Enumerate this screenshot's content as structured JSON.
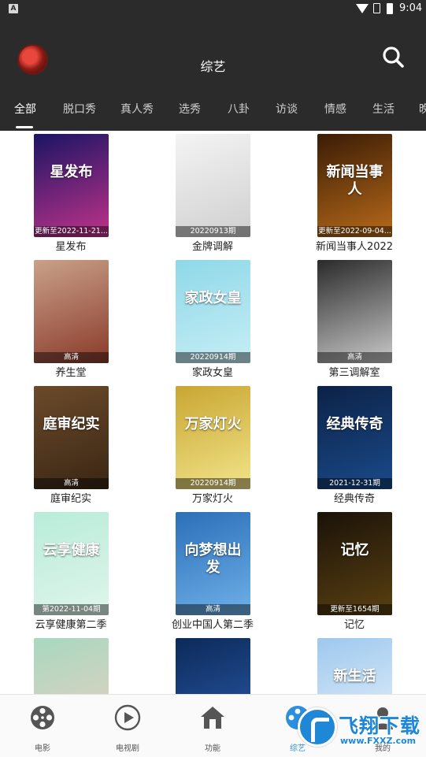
{
  "status_bar": {
    "notification_icon": "A",
    "time": "9:04"
  },
  "header": {
    "title": "综艺",
    "avatar": "avatar",
    "search_icon": "search-icon"
  },
  "tabs": [
    {
      "label": "全部",
      "active": true
    },
    {
      "label": "脱口秀"
    },
    {
      "label": "真人秀"
    },
    {
      "label": "选秀"
    },
    {
      "label": "八卦"
    },
    {
      "label": "访谈"
    },
    {
      "label": "情感"
    },
    {
      "label": "生活"
    },
    {
      "label": "晚"
    }
  ],
  "grid": [
    {
      "name": "星发布",
      "badge": "更新至2022-11-21...",
      "art": "星发布",
      "colors": [
        "#1b1464",
        "#c0338a"
      ]
    },
    {
      "name": "金牌调解",
      "badge": "20220913期",
      "art": "",
      "colors": [
        "#f4f4f4",
        "#cfcfcf"
      ]
    },
    {
      "name": "新闻当事人2022",
      "badge": "更新至2022-09-04...",
      "art": "新闻当事人",
      "colors": [
        "#3a1c05",
        "#b86a1a"
      ]
    },
    {
      "name": "养生堂",
      "badge": "高清",
      "art": "",
      "colors": [
        "#c9a18a",
        "#8a3a2a"
      ]
    },
    {
      "name": "家政女皇",
      "badge": "20220914期",
      "art": "家政女皇",
      "colors": [
        "#8fd8e8",
        "#c6eef5"
      ]
    },
    {
      "name": "第三调解室",
      "badge": "高清",
      "art": "",
      "colors": [
        "#2a2a2a",
        "#c9c9c9"
      ]
    },
    {
      "name": "庭审纪实",
      "badge": "高清",
      "art": "庭审纪实",
      "colors": [
        "#6b4a2a",
        "#3a2614"
      ]
    },
    {
      "name": "万家灯火",
      "badge": "20220914期",
      "art": "万家灯火",
      "colors": [
        "#c9a632",
        "#f2e48a"
      ]
    },
    {
      "name": "经典传奇",
      "badge": "2021-12-31期",
      "art": "经典传奇",
      "colors": [
        "#0c2247",
        "#1a4a8a"
      ]
    },
    {
      "name": "云享健康第二季",
      "badge": "第2022-11-04期",
      "art": "云享健康",
      "colors": [
        "#b8ecd9",
        "#e0f5ec"
      ]
    },
    {
      "name": "创业中国人第二季",
      "badge": "高清",
      "art": "向梦想出发",
      "colors": [
        "#2b6fb8",
        "#6fb0e8"
      ]
    },
    {
      "name": "记忆",
      "badge": "更新至1654期",
      "art": "记忆",
      "colors": [
        "#1a1208",
        "#5a4012"
      ]
    },
    {
      "name": "",
      "badge": "",
      "art": "",
      "colors": [
        "#a8d8c0",
        "#e8d0c0"
      ]
    },
    {
      "name": "",
      "badge": "",
      "art": "",
      "colors": [
        "#0c2a5a",
        "#2a5aa8"
      ]
    },
    {
      "name": "",
      "badge": "",
      "art": "新生活",
      "colors": [
        "#9ec8ee",
        "#e8f2fb"
      ]
    }
  ],
  "bottom_nav": [
    {
      "label": "电影",
      "icon": "film-reel-icon"
    },
    {
      "label": "电视剧",
      "icon": "play-circle-icon"
    },
    {
      "label": "功能",
      "icon": "home-icon"
    },
    {
      "label": "综艺",
      "icon": "variety-icon",
      "active": true
    },
    {
      "label": "我的",
      "icon": "profile-icon"
    }
  ],
  "watermark": {
    "text": "飞翔下载",
    "url": "www.FXXZ.com"
  },
  "colors": {
    "header_bg": "#2b2b2b",
    "accent": "#2b8fe0",
    "watermark": "#1e88d6"
  }
}
